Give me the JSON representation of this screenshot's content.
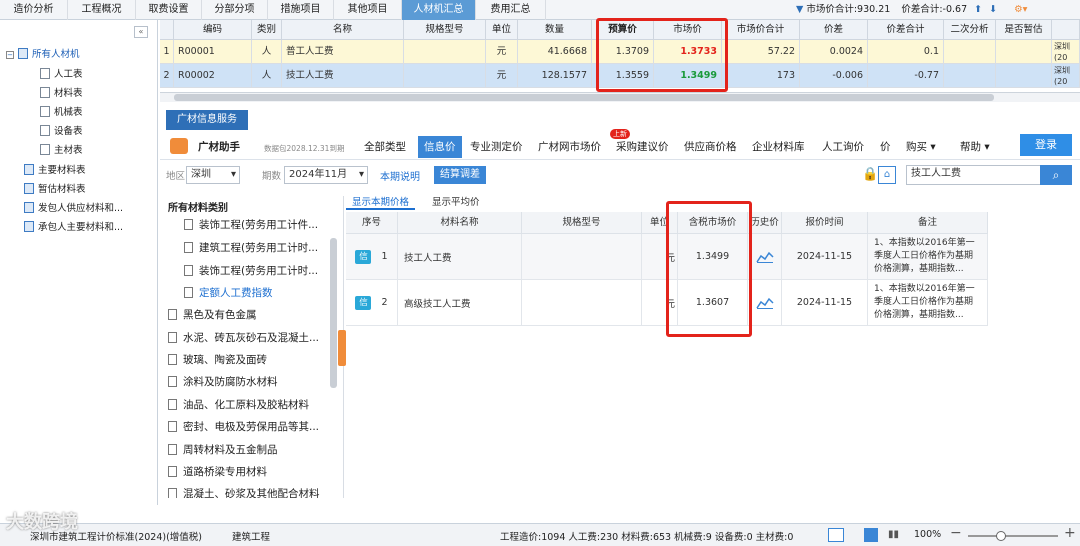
{
  "top_tabs": [
    {
      "label": "造价分析"
    },
    {
      "label": "工程概况"
    },
    {
      "label": "取费设置"
    },
    {
      "label": "分部分项"
    },
    {
      "label": "措施项目"
    },
    {
      "label": "其他项目"
    },
    {
      "label": "人材机汇总"
    },
    {
      "label": "费用汇总"
    }
  ],
  "summary": {
    "market_total": "市场价合计:930.21",
    "diff_total": "价差合计:-0.67"
  },
  "tree": {
    "root": "所有人材机",
    "children": [
      "人工表",
      "材料表",
      "机械表",
      "设备表",
      "主材表"
    ],
    "others": [
      "主要材料表",
      "暂估材料表",
      "发包人供应材料和...",
      "承包人主要材料和..."
    ]
  },
  "grid": {
    "headers": [
      "编码",
      "类别",
      "名称",
      "规格型号",
      "单位",
      "数量",
      "预算价",
      "市场价",
      "市场价合计",
      "价差",
      "价差合计",
      "二次分析",
      "是否暂估"
    ],
    "rows": [
      {
        "idx": "1",
        "code": "R00001",
        "cat": "人",
        "name": "普工人工费",
        "spec": "",
        "unit": "元",
        "qty": "41.6668",
        "budget": "1.3709",
        "market": "1.3733",
        "market_total": "57.22",
        "diff": "0.0024",
        "diff_total": "0.1",
        "extra": "深圳\n(20"
      },
      {
        "idx": "2",
        "code": "R00002",
        "cat": "人",
        "name": "技工人工费",
        "spec": "",
        "unit": "元",
        "qty": "128.1577",
        "budget": "1.3559",
        "market": "1.3499",
        "market_total": "173",
        "diff": "-0.006",
        "diff_total": "-0.77",
        "extra": "深圳\n(20"
      }
    ],
    "colors": {
      "market_up": "#e3231b",
      "market_down": "#1a9a3a"
    }
  },
  "service_tab": "广材信息服务",
  "nav": {
    "brand": "广材助手",
    "data_note": "数据包2028.12.31到期",
    "items": [
      "全部类型",
      "信息价",
      "专业测定价",
      "广材网市场价",
      "采购建议价",
      "供应商价格",
      "企业材料库",
      "人工询价",
      "价"
    ],
    "badge": "上新",
    "buy": "购买",
    "help": "帮助",
    "login": "登录"
  },
  "filters": {
    "region_label": "地区",
    "region": "深圳",
    "period_label": "期数",
    "period": "2024年11月",
    "explain": "本期说明",
    "adjust": "结算调差",
    "search_value": "技工人工费"
  },
  "categories": {
    "header": "所有材料类别",
    "items": [
      {
        "label": "装饰工程(劳务用工计件...",
        "level": 2
      },
      {
        "label": "建筑工程(劳务用工计时...",
        "level": 2
      },
      {
        "label": "装饰工程(劳务用工计时...",
        "level": 2
      },
      {
        "label": "定额人工费指数",
        "level": 2,
        "selected": true
      },
      {
        "label": "黑色及有色金属",
        "level": 1
      },
      {
        "label": "水泥、砖瓦灰砂石及混凝土...",
        "level": 1
      },
      {
        "label": "玻璃、陶瓷及面砖",
        "level": 1
      },
      {
        "label": "涂料及防腐防水材料",
        "level": 1
      },
      {
        "label": "油品、化工原料及胶粘材料",
        "level": 1
      },
      {
        "label": "密封、电极及劳保用品等其...",
        "level": 1
      },
      {
        "label": "周转材料及五金制品",
        "level": 1
      },
      {
        "label": "道路桥梁专用材料",
        "level": 1
      },
      {
        "label": "混凝土、砂浆及其他配合材料",
        "level": 1
      }
    ]
  },
  "result_tabs": [
    "显示本期价格",
    "显示平均价"
  ],
  "results": {
    "headers": [
      "序号",
      "材料名称",
      "规格型号",
      "单位",
      "含税市场价",
      "历史价",
      "报价时间",
      "备注"
    ],
    "rows": [
      {
        "tag": "信",
        "idx": "1",
        "name": "技工人工费",
        "spec": "",
        "unit": "元",
        "price": "1.3499",
        "date": "2024-11-15",
        "note": "1、本指数以2016年第一季度人工日价格作为基期价格测算，基期指数..."
      },
      {
        "tag": "信",
        "idx": "2",
        "name": "高级技工人工费",
        "spec": "",
        "unit": "元",
        "price": "1.3607",
        "date": "2024-11-15",
        "note": "1、本指数以2016年第一季度人工日价格作为基期价格测算，基期指数..."
      }
    ]
  },
  "status": {
    "project": "深圳市建筑工程计价标准(2024)(增值税)",
    "type": "建筑工程",
    "totals": "工程造价:1094  人工费:230  材料费:653  机械费:9  设备费:0  主材费:0",
    "zoom": "100%"
  },
  "watermark": "大数跨境"
}
